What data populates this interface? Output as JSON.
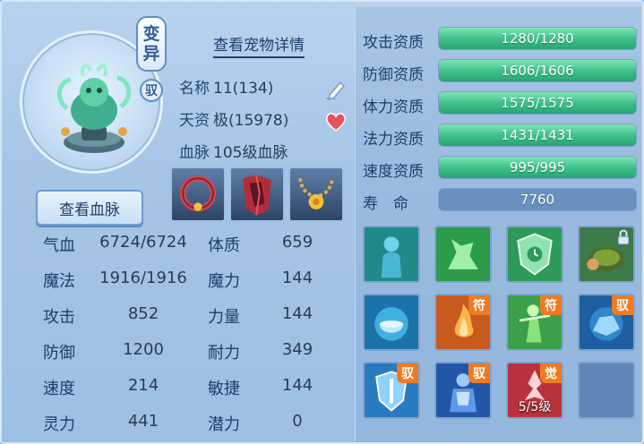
{
  "pet": {
    "mutation_badge": [
      "变",
      "异"
    ],
    "tame_badge": "驭",
    "detail_link": "查看宠物详情",
    "name_label": "名称",
    "name_value": "11(134)",
    "talent_label": "天资",
    "talent_value": "极(15978)",
    "bloodline_label": "血脉",
    "bloodline_value": "105级血脉",
    "view_bloodline_button": "查看血脉"
  },
  "stats": [
    {
      "label": "气血",
      "value": "6724/6724",
      "label2": "体质",
      "value2": "659"
    },
    {
      "label": "魔法",
      "value": "1916/1916",
      "label2": "魔力",
      "value2": "144"
    },
    {
      "label": "攻击",
      "value": "852",
      "label2": "力量",
      "value2": "144"
    },
    {
      "label": "防御",
      "value": "1200",
      "label2": "耐力",
      "value2": "349"
    },
    {
      "label": "速度",
      "value": "214",
      "label2": "敏捷",
      "value2": "144"
    },
    {
      "label": "灵力",
      "value": "441",
      "label2": "潜力",
      "value2": "0"
    }
  ],
  "aptitudes": [
    {
      "label": "攻击资质",
      "text": "1280/1280",
      "fill": 1.0
    },
    {
      "label": "防御资质",
      "text": "1606/1606",
      "fill": 1.0
    },
    {
      "label": "体力资质",
      "text": "1575/1575",
      "fill": 1.0
    },
    {
      "label": "法力资质",
      "text": "1431/1431",
      "fill": 1.0
    },
    {
      "label": "速度资质",
      "text": "995/995",
      "fill": 1.0
    }
  ],
  "life": {
    "label": "寿　命",
    "text": "7760"
  },
  "skills": {
    "tag_fu": "符",
    "tag_yu": "驭",
    "tag_jue": "觉",
    "level_text": "5/5级"
  },
  "colors": {
    "bar_green": "#3fc18a",
    "tag_orange": "#f07a22",
    "text_blue": "#1d3e6b"
  }
}
